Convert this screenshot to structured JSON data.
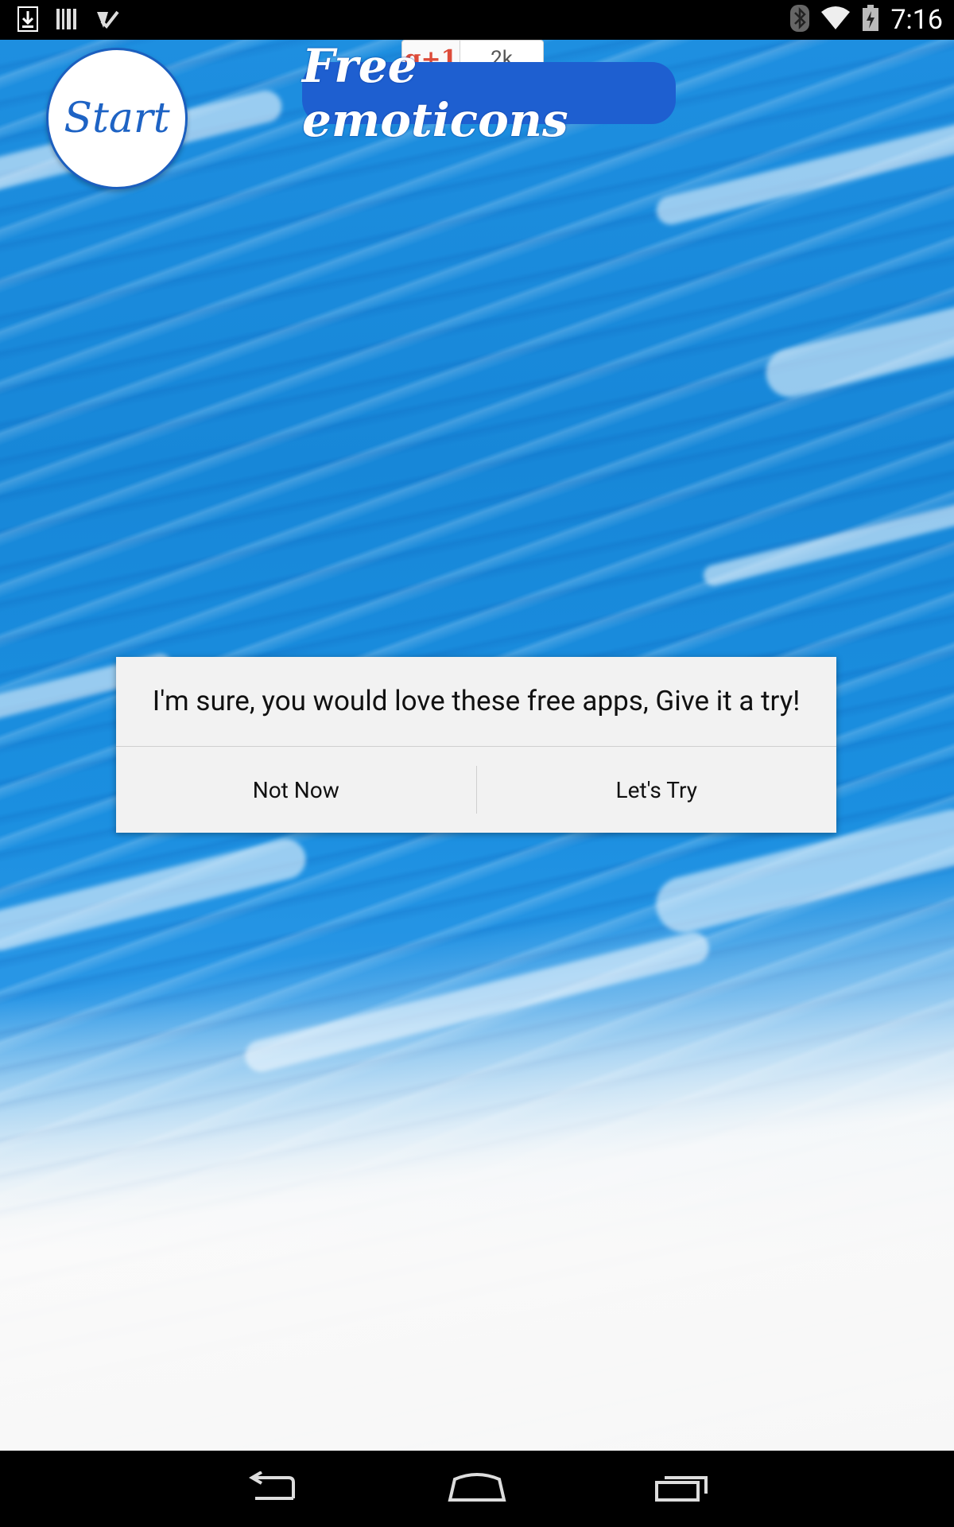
{
  "status_bar": {
    "time": "7:16",
    "left_icons": [
      "download-icon",
      "barcode-icon",
      "checkmark-icon"
    ],
    "right_icons": [
      "bluetooth-icon",
      "wifi-icon",
      "battery-icon"
    ]
  },
  "header": {
    "start_label": "Start",
    "app_title": "Free emoticons",
    "gplus": {
      "button_label": "g+1",
      "count": "2k"
    }
  },
  "dialog": {
    "message": "I'm sure, you would love these free apps, Give it a try!",
    "negative_label": "Not Now",
    "positive_label": "Let's Try"
  },
  "nav_bar": {
    "icons": [
      "back-icon",
      "home-icon",
      "recents-icon"
    ]
  },
  "colors": {
    "wallpaper_blue": "#1b8fe0",
    "title_bg": "#1e5fd0",
    "start_text": "#1e63c4",
    "dialog_bg": "#f2f2f2"
  }
}
